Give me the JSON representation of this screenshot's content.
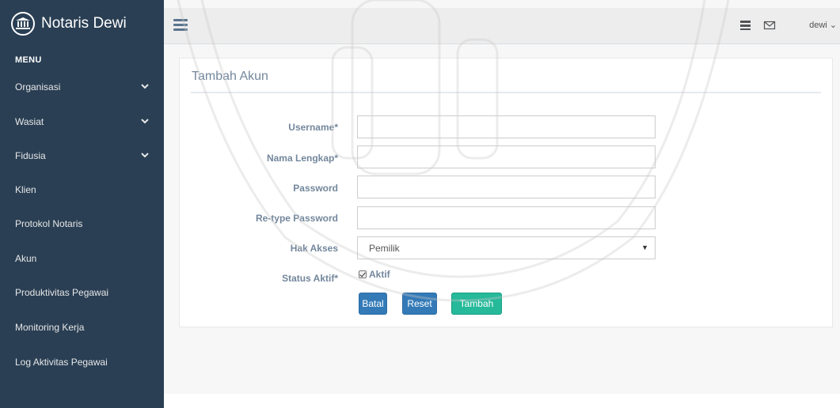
{
  "brand": {
    "title": "Notaris Dewi",
    "icon": "bank-icon"
  },
  "sidebar": {
    "heading": "MENU",
    "items": [
      {
        "label": "Organisasi",
        "has_submenu": true
      },
      {
        "label": "Wasiat",
        "has_submenu": true
      },
      {
        "label": "Fidusia",
        "has_submenu": true
      },
      {
        "label": "Klien",
        "has_submenu": false
      },
      {
        "label": "Protokol Notaris",
        "has_submenu": false
      },
      {
        "label": "Akun",
        "has_submenu": false
      },
      {
        "label": "Produktivitas Pegawai",
        "has_submenu": false
      },
      {
        "label": "Monitoring Kerja",
        "has_submenu": false
      },
      {
        "label": "Log Aktivitas Pegawai",
        "has_submenu": false
      }
    ]
  },
  "topnav": {
    "user": "dewi",
    "icons": [
      "menu-icon",
      "list-icon",
      "envelope-icon"
    ]
  },
  "panel": {
    "title": "Tambah Akun"
  },
  "form": {
    "username_label": "Username*",
    "username_value": "",
    "nama_label": "Nama Lengkap*",
    "nama_value": "",
    "password_label": "Password",
    "password_value": "",
    "retype_label": "Re-type Password",
    "retype_value": "",
    "hak_label": "Hak Akses",
    "hak_value": "Pemilik",
    "status_label": "Status Aktif*",
    "status_checkbox_label": "Aktif",
    "status_checked": true
  },
  "buttons": {
    "batal": "Batal",
    "reset": "Reset",
    "tambah": "Tambah"
  },
  "colors": {
    "sidebar": "#2a3f54",
    "topnav": "#ededed",
    "primary": "#337ab7",
    "success": "#26b99a",
    "label": "#73879c"
  }
}
